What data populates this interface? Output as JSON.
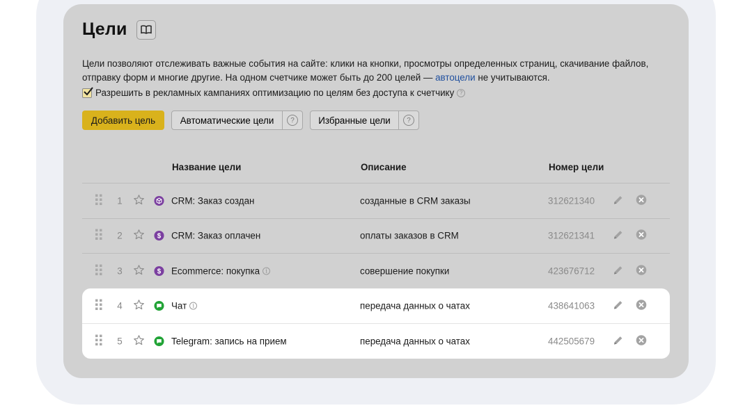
{
  "colors": {
    "accent_yellow": "#d9b21c",
    "link_blue": "#1f4f9e",
    "crm_purple": "#7b3fa0",
    "chat_green": "#21a336",
    "panel_gray": "#d1d1d1"
  },
  "header": {
    "title": "Цели",
    "book_icon": "book-icon"
  },
  "description": {
    "text": "Цели позволяют отслеживать важные события на сайте: клики на кнопки, просмотры определенных страниц, скачивание файлов, отправку форм и многие другие. На одном счетчике может быть до 200 целей — ",
    "link_text": "автоцели",
    "suffix": " не учитываются."
  },
  "checkbox": {
    "checked": true,
    "label": "Разрешить в рекламных кампаниях оптимизацию по целям без доступа к счетчику",
    "help": "?"
  },
  "buttons": {
    "add_goal": "Добавить цель",
    "auto_goals": "Автоматические цели",
    "favorite_goals": "Избранные цели",
    "help": "?"
  },
  "table": {
    "headers": {
      "name": "Название цели",
      "description": "Описание",
      "id": "Номер цели"
    },
    "rows": [
      {
        "num": "1",
        "icon": "cube-icon",
        "name": "CRM: Заказ создан",
        "info": "",
        "description": "созданные в CRM заказы",
        "id": "312621340",
        "highlighted": false
      },
      {
        "num": "2",
        "icon": "dollar-icon",
        "name": "CRM: Заказ оплачен",
        "info": "",
        "description": "оплаты заказов в CRM",
        "id": "312621341",
        "highlighted": false
      },
      {
        "num": "3",
        "icon": "dollar-icon",
        "name": "Ecommerce: покупка",
        "info": "i",
        "description": "совершение покупки",
        "id": "423676712",
        "highlighted": false
      },
      {
        "num": "4",
        "icon": "chat-icon",
        "name": "Чат",
        "info": "i",
        "description": "передача данных о чатах",
        "id": "438641063",
        "highlighted": true
      },
      {
        "num": "5",
        "icon": "chat-icon",
        "name": "Telegram: запись на прием",
        "info": "",
        "description": "передача данных о чатах",
        "id": "442505679",
        "highlighted": true
      }
    ]
  }
}
